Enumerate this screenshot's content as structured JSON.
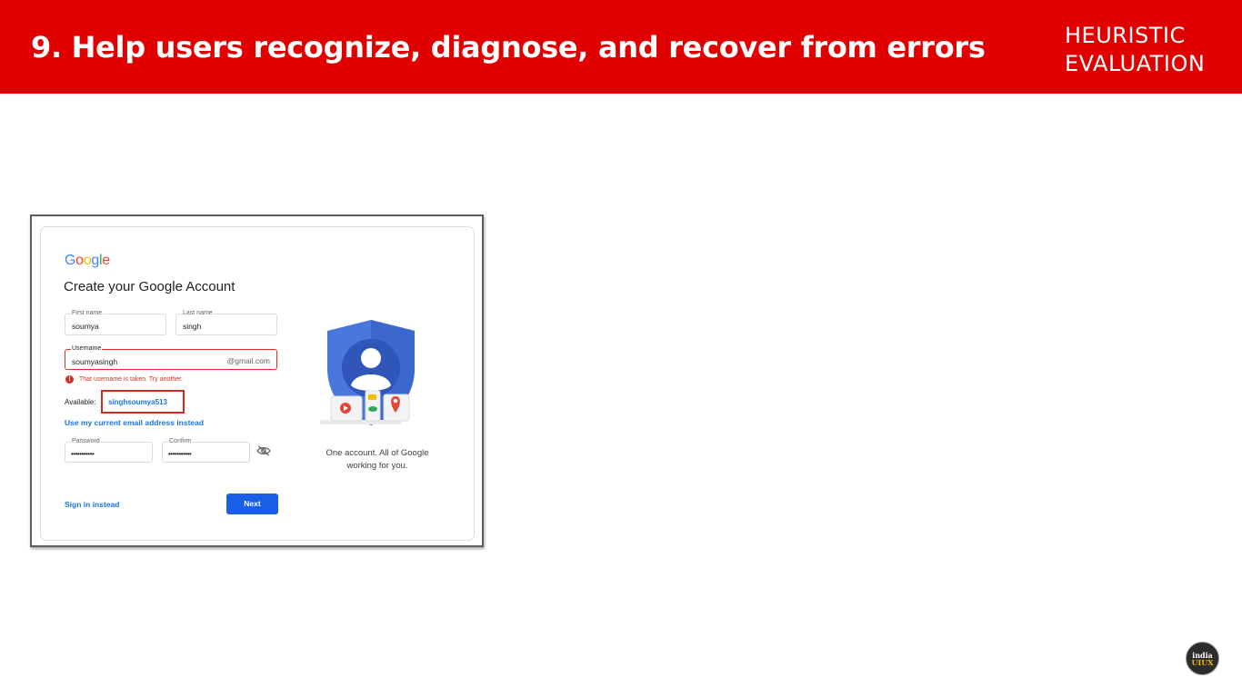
{
  "header": {
    "title": "9. Help users recognize, diagnose, and recover from errors",
    "tag_line1": "HEURISTIC",
    "tag_line2": "EVALUATION",
    "color": "#e00000"
  },
  "form": {
    "logo_letters": [
      {
        "ch": "G",
        "color": "#4285f4"
      },
      {
        "ch": "o",
        "color": "#ea4335"
      },
      {
        "ch": "o",
        "color": "#fbbc05"
      },
      {
        "ch": "g",
        "color": "#4285f4"
      },
      {
        "ch": "l",
        "color": "#34a853"
      },
      {
        "ch": "e",
        "color": "#ea4335"
      }
    ],
    "title": "Create your Google Account",
    "first_name": {
      "label": "First name",
      "value": "soumya"
    },
    "last_name": {
      "label": "Last name",
      "value": "singh"
    },
    "username": {
      "label": "Username",
      "value": "soumyasingh",
      "suffix": "@gmail.com"
    },
    "error_text": "That username is taken. Try another.",
    "available_label": "Available:",
    "available_suggestion": "singhsoumya513",
    "use_email_link": "Use my current email address instead",
    "password": {
      "label": "Password",
      "value": "•••••••••••"
    },
    "confirm": {
      "label": "Confirm",
      "value": "•••••••••••"
    },
    "toggle_icon": "eye-off-icon",
    "sign_in_link": "Sign in instead",
    "next_button": "Next",
    "tagline": "One account. All of Google working for you.",
    "accent": "#1a73e8",
    "error_color": "#d93025"
  },
  "watermark": {
    "top": "india",
    "bottom": "UIUX"
  }
}
